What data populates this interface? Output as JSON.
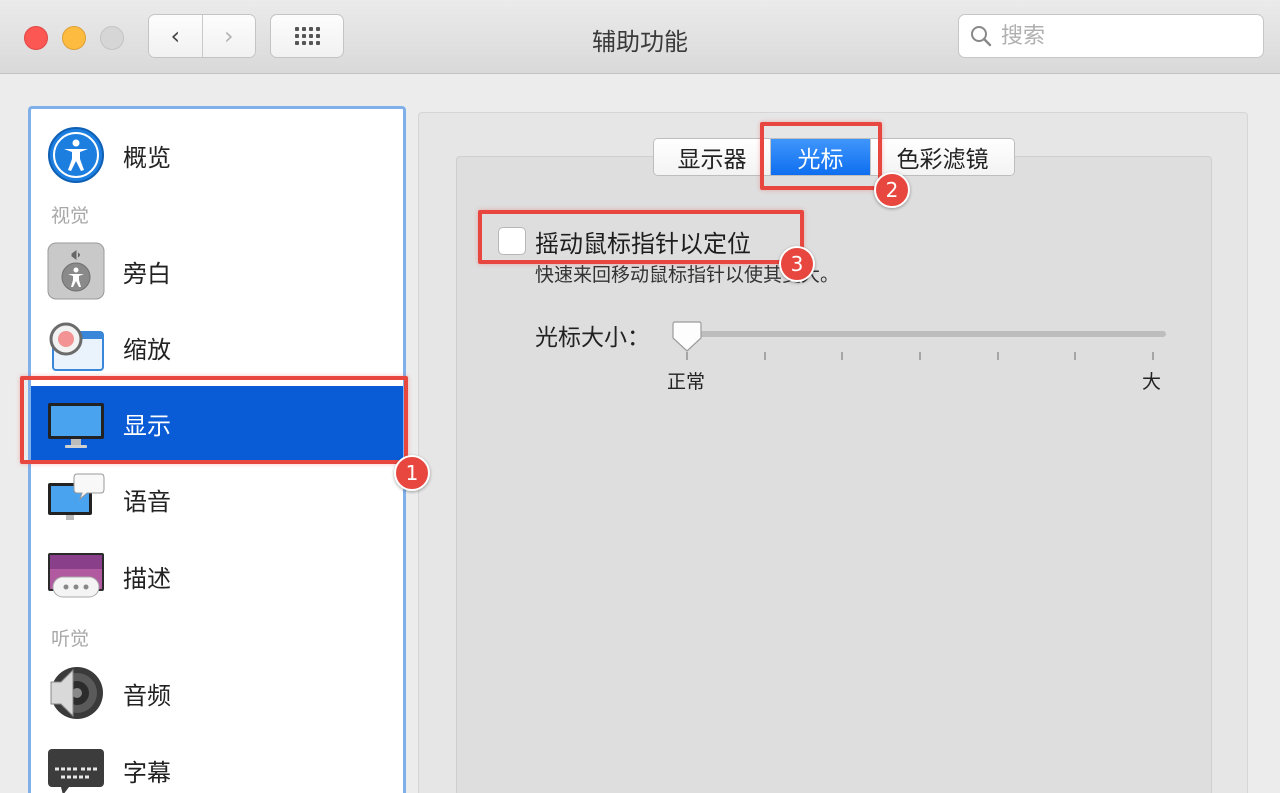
{
  "window": {
    "title": "辅助功能"
  },
  "toolbar": {
    "back_icon": "‹",
    "forward_icon": "›",
    "search_placeholder": "搜索"
  },
  "sidebar": {
    "items": [
      {
        "label": "概览",
        "icon": "accessibility-icon"
      },
      {
        "label": "旁白",
        "icon": "voiceover-icon"
      },
      {
        "label": "缩放",
        "icon": "zoom-icon"
      },
      {
        "label": "显示",
        "icon": "display-icon",
        "selected": true
      },
      {
        "label": "语音",
        "icon": "speech-icon"
      },
      {
        "label": "描述",
        "icon": "descriptions-icon"
      },
      {
        "label": "音频",
        "icon": "speaker-icon"
      },
      {
        "label": "字幕",
        "icon": "captions-icon"
      }
    ],
    "sections": {
      "vision": "视觉",
      "hearing": "听觉"
    }
  },
  "tabs": [
    {
      "label": "显示器",
      "active": false
    },
    {
      "label": "光标",
      "active": true
    },
    {
      "label": "色彩滤镜",
      "active": false
    }
  ],
  "cursor_panel": {
    "shake_checkbox_label": "摇动鼠标指针以定位",
    "shake_checkbox_checked": false,
    "shake_description": "快速来回移动鼠标指针以使其变大。",
    "size_label": "光标大小：",
    "size_min_label": "正常",
    "size_max_label": "大",
    "size_value": 0
  },
  "annotations": [
    "1",
    "2",
    "3"
  ],
  "colors": {
    "selection": "#0a5bd6",
    "accent_tab": "#1a78f4",
    "annotation": "#e8473f"
  }
}
